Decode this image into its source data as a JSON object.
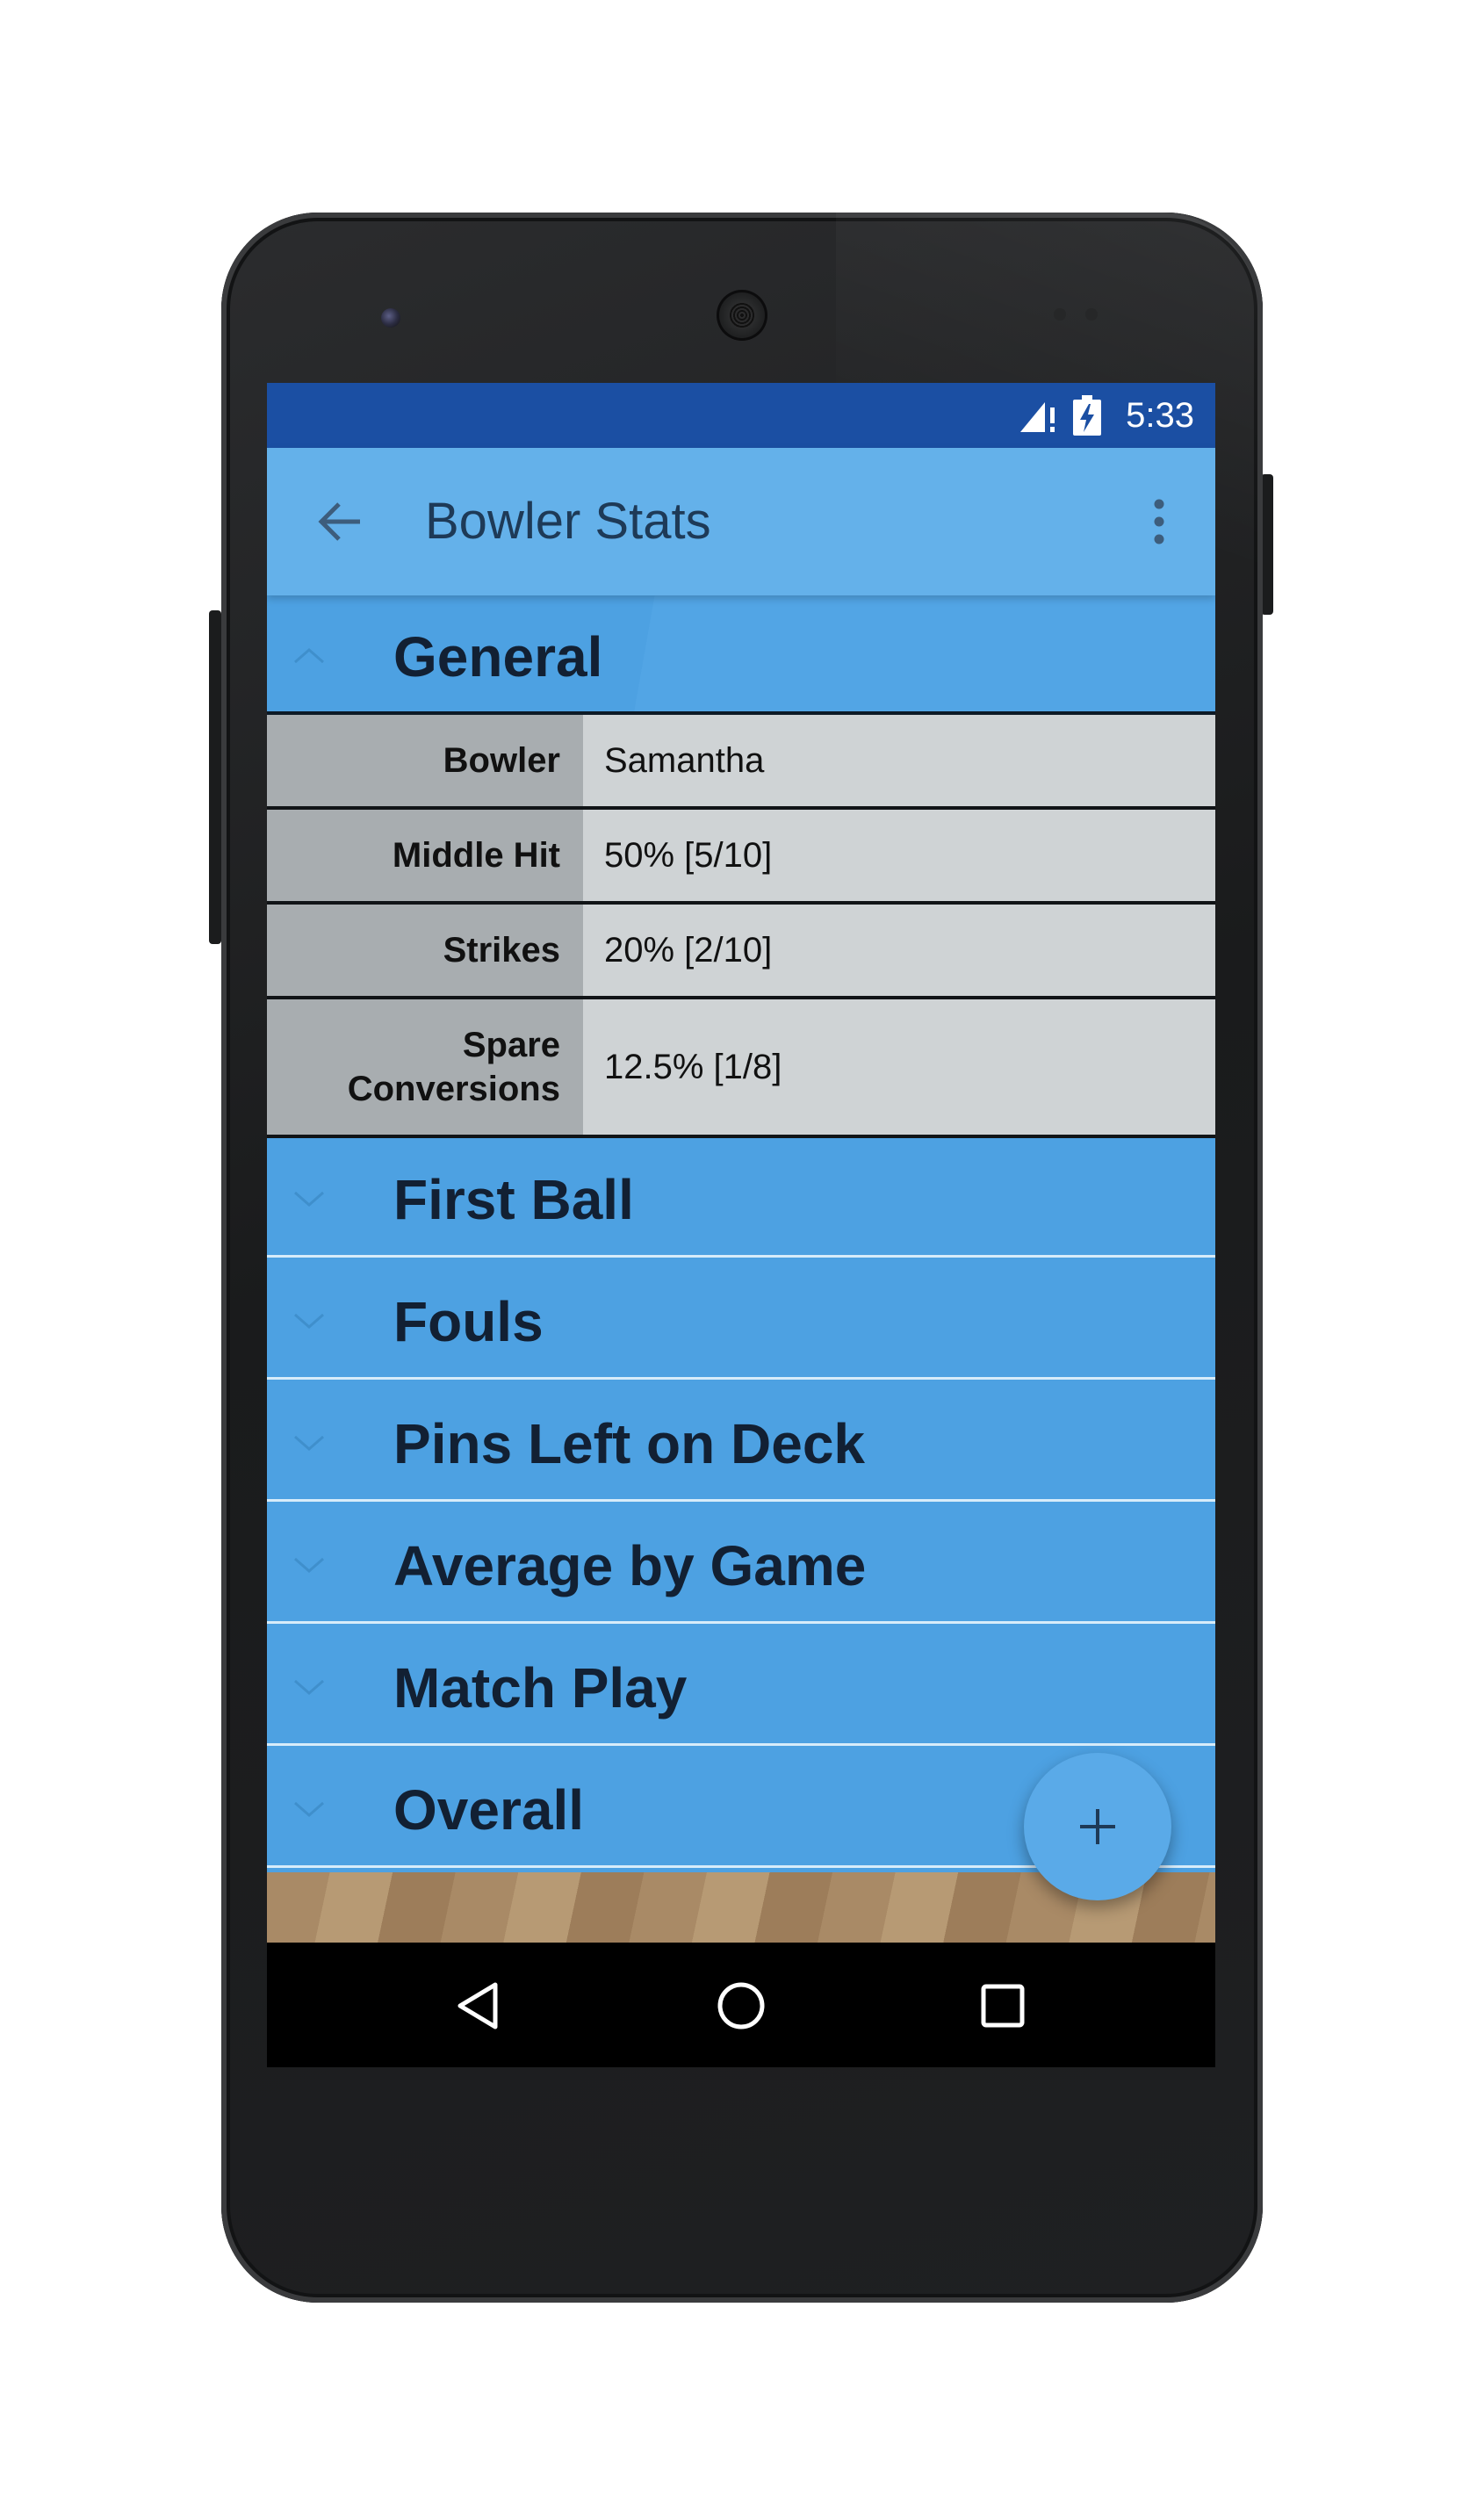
{
  "status_bar": {
    "time": "5:33",
    "icons": [
      "signal-icon",
      "battery-charging-icon"
    ]
  },
  "app_bar": {
    "title": "Bowler Stats",
    "icons": [
      "back-arrow-icon",
      "overflow-menu-icon"
    ]
  },
  "sections": [
    {
      "title": "General",
      "expanded": true
    },
    {
      "title": "First Ball",
      "expanded": false
    },
    {
      "title": "Fouls",
      "expanded": false
    },
    {
      "title": "Pins Left on Deck",
      "expanded": false
    },
    {
      "title": "Average by Game",
      "expanded": false
    },
    {
      "title": "Match Play",
      "expanded": false
    },
    {
      "title": "Overall",
      "expanded": false
    }
  ],
  "general_stats": [
    {
      "label": "Bowler",
      "value": "Samantha"
    },
    {
      "label": "Middle Hit",
      "value": "50% [5/10]"
    },
    {
      "label": "Strikes",
      "value": "20% [2/10]"
    },
    {
      "label": "Spare Conversions",
      "value": "12.5% [1/8]"
    }
  ],
  "fab": {
    "icon": "plus-icon"
  },
  "nav_bar": {
    "icons": [
      "back-triangle-icon",
      "home-circle-icon",
      "recents-square-icon"
    ]
  },
  "colors": {
    "status_bar": "#1b4fa3",
    "app_bar": "#64b1ea",
    "section_header": "#4da1e2",
    "stat_label_bg": "#a8adb0",
    "stat_value_bg": "#cfd3d5",
    "fab": "#5aaae8"
  }
}
